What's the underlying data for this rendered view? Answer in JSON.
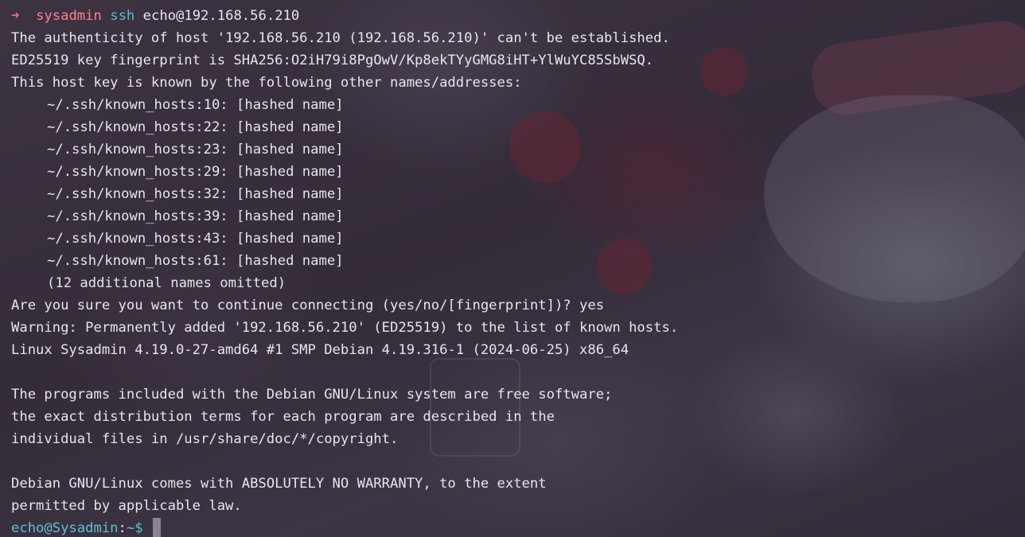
{
  "prompt": {
    "arrow": "➜",
    "dir": "sysadmin",
    "command": "ssh",
    "argument": "echo@192.168.56.210"
  },
  "output": {
    "authenticity": "The authenticity of host '192.168.56.210 (192.168.56.210)' can't be established.",
    "fingerprint": "ED25519 key fingerprint is SHA256:O2iH79i8PgOwV/Kp8ekTYyGMG8iHT+YlWuYC85SbWSQ.",
    "known_by": "This host key is known by the following other names/addresses:",
    "known_hosts": [
      "~/.ssh/known_hosts:10: [hashed name]",
      "~/.ssh/known_hosts:22: [hashed name]",
      "~/.ssh/known_hosts:23: [hashed name]",
      "~/.ssh/known_hosts:29: [hashed name]",
      "~/.ssh/known_hosts:32: [hashed name]",
      "~/.ssh/known_hosts:39: [hashed name]",
      "~/.ssh/known_hosts:43: [hashed name]",
      "~/.ssh/known_hosts:61: [hashed name]"
    ],
    "omitted": "(12 additional names omitted)",
    "confirm": "Are you sure you want to continue connecting (yes/no/[fingerprint])? yes",
    "warning": "Warning: Permanently added '192.168.56.210' (ED25519) to the list of known hosts.",
    "uname": "Linux Sysadmin 4.19.0-27-amd64 #1 SMP Debian 4.19.316-1 (2024-06-25) x86_64",
    "motd_1": "The programs included with the Debian GNU/Linux system are free software;",
    "motd_2": "the exact distribution terms for each program are described in the",
    "motd_3": "individual files in /usr/share/doc/*/copyright.",
    "motd_4": "Debian GNU/Linux comes with ABSOLUTELY NO WARRANTY, to the extent",
    "motd_5": "permitted by applicable law."
  },
  "remote_prompt": {
    "user_host": "echo@Sysadmin",
    "colon": ":",
    "path": "~$"
  }
}
